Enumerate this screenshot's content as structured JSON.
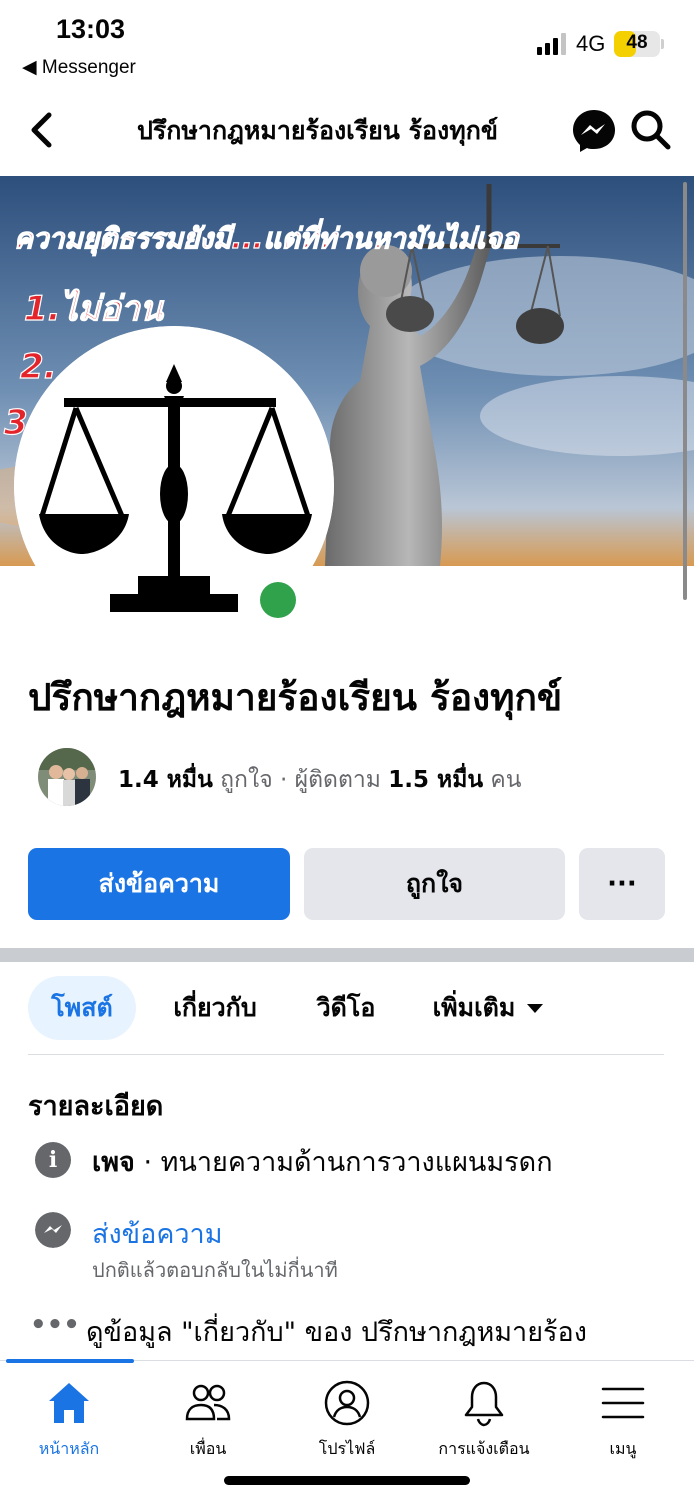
{
  "status_bar": {
    "time": "13:03",
    "back_app": "◀ Messenger",
    "network": "4G",
    "battery": "48",
    "battery_level": 0.48
  },
  "header": {
    "title": "ปรึกษากฎหมายร้องเรียน ร้องทุกข์"
  },
  "profile": {
    "page_name": "ปรึกษากฎหมายร้องเรียน ร้องทุกข์",
    "likes_count": "1.4 หมื่น",
    "likes_label": "ถูกใจ",
    "separator": "·",
    "followers_label": "ผู้ติดตาม",
    "followers_count": "1.5 หมื่น",
    "followers_unit": "คน"
  },
  "cover": {
    "headline": "ความยุติธรรมยังมี...แต่ที่ท่านหามันไม่เจอ",
    "item1": "1.ไม่อ่าน",
    "item2": "2.",
    "item3": "3."
  },
  "actions": {
    "message": "ส่งข้อความ",
    "like": "ถูกใจ",
    "more": "···"
  },
  "tabs": {
    "posts": "โพสต์",
    "about": "เกี่ยวกับ",
    "videos": "วิดีโอ",
    "more": "เพิ่มเติม"
  },
  "details": {
    "title": "รายละเอียด",
    "category_label": "เพจ",
    "category_sep": " · ",
    "category": "ทนายความด้านการวางแผนมรดก",
    "message_link": "ส่งข้อความ",
    "response_time": "ปกติแล้วตอบกลับในไม่กี่นาที",
    "about_link": "ดูข้อมูล \"เกี่ยวกับ\" ของ ปรึกษากฎหมายร้อง"
  },
  "bottom_nav": {
    "home": "หน้าหลัก",
    "friends": "เพื่อน",
    "profile": "โปรไฟล์",
    "notifications": "การแจ้งเตือน",
    "menu": "เมนู"
  },
  "colors": {
    "accent": "#1b74e4",
    "online": "#31a24c",
    "secondary_text": "#65676b",
    "button_grey": "#e4e6eb",
    "battery_yellow": "#f5d000"
  }
}
